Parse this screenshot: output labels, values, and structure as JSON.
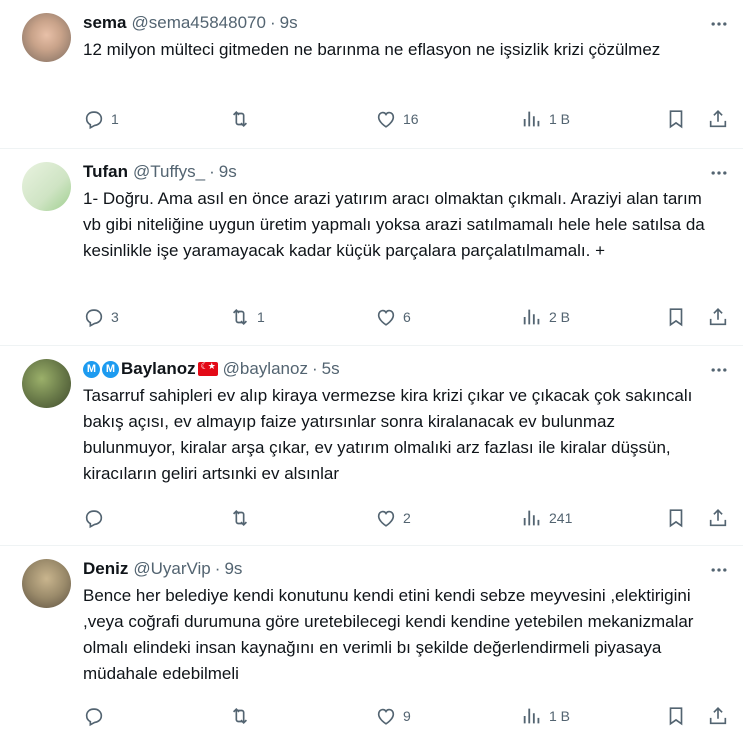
{
  "tweets": [
    {
      "name": "sema",
      "handle": "@sema45848070",
      "time": "9s",
      "text": "12 milyon mülteci gitmeden ne barınma ne eflasyon ne işsizlik krizi çözülmez",
      "replies": "1",
      "retweets": "",
      "likes": "16",
      "views": "1 B",
      "avatar_color": "#c9a38a"
    },
    {
      "name": "Tufan",
      "handle": "@Tuffys_",
      "time": "9s",
      "text": "1- Doğru. Ama asıl en önce arazi yatırım aracı olmaktan çıkmalı. Araziyi alan tarım vb gibi niteliğine uygun üretim yapmalı yoksa arazi satılmamalı hele hele satılsa da kesinlikle işe yaramayacak kadar küçük parçalara parçalatılmamalı. +",
      "replies": "3",
      "retweets": "1",
      "likes": "6",
      "views": "2 B",
      "avatar_color": "#d7ead0"
    },
    {
      "name": "Baylanoz",
      "handle": "@baylanoz",
      "time": "5s",
      "text": "Tasarruf sahipleri ev alıp kiraya vermezse kira krizi çıkar ve çıkacak çok sakıncalı bakış açısı, ev almayıp faize yatırsınlar sonra kiralanacak ev bulunmaz bulunmuyor, kiralar arşa çıkar, ev yatırım olmalıki arz fazlası ile kiralar düşsün, kiracıların geliri artsınki ev alsınlar",
      "replies": "",
      "retweets": "",
      "likes": "2",
      "views": "241",
      "avatar_color": "#6b7c4a",
      "badges": [
        "M",
        "M"
      ]
    },
    {
      "name": "Deniz",
      "handle": "@UyarVip",
      "time": "9s",
      "text": "Bence her belediye kendi  konutunu kendi etini  kendi sebze meyvesini ,elektirigini ,veya coğrafi durumuna göre  uretebilecegi kendi kendine yetebilen mekanizmalar olmalı  elindeki insan kaynağını en verimli bı şekilde değerlendirmeli  piyasaya  müdahale edebilmeli",
      "replies": "",
      "retweets": "",
      "likes": "9",
      "views": "1 B",
      "avatar_color": "#9a8a6a"
    }
  ],
  "icons": {
    "more": "more-icon",
    "reply": "reply-icon",
    "retweet": "retweet-icon",
    "like": "like-icon",
    "views": "views-icon",
    "bookmark": "bookmark-icon",
    "share": "share-icon"
  }
}
